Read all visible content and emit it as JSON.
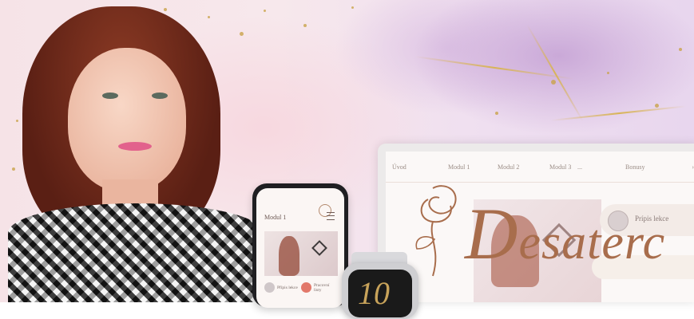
{
  "laptop": {
    "nav": [
      "Úvod",
      "Modul 1",
      "Modul 2",
      "Modul 3",
      "...",
      "Bonusy"
    ],
    "card_label": "Prípis lekce"
  },
  "logo": {
    "cap": "D",
    "rest": "esaterc"
  },
  "phone": {
    "title": "Modul 1",
    "chips": [
      {
        "label": "Přípis lekce",
        "color": "#cfc7c9"
      },
      {
        "label": "Pracovní listy",
        "color": "#e2786a"
      }
    ]
  },
  "watch": {
    "number": "10"
  },
  "colors": {
    "accent_brown": "#a86d4c",
    "gold": "#c9a34a"
  }
}
